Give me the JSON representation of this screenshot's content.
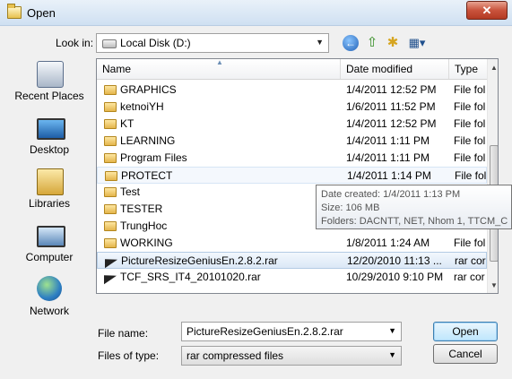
{
  "window": {
    "title": "Open",
    "close_label": "✕"
  },
  "toolbar": {
    "look_in_label": "Look in:",
    "look_in_value": "Local Disk (D:)"
  },
  "places": [
    {
      "label": "Recent Places",
      "icon": "recent-places-icon"
    },
    {
      "label": "Desktop",
      "icon": "desktop-icon"
    },
    {
      "label": "Libraries",
      "icon": "libraries-icon"
    },
    {
      "label": "Computer",
      "icon": "computer-icon"
    },
    {
      "label": "Network",
      "icon": "network-icon"
    }
  ],
  "columns": {
    "name": "Name",
    "date": "Date modified",
    "type": "Type"
  },
  "files": [
    {
      "name": "GRAPHICS",
      "date": "1/4/2011 12:52 PM",
      "type": "File fol",
      "kind": "folder"
    },
    {
      "name": "ketnoiYH",
      "date": "1/6/2011 11:52 PM",
      "type": "File fol",
      "kind": "folder"
    },
    {
      "name": "KT",
      "date": "1/4/2011 12:52 PM",
      "type": "File fol",
      "kind": "folder"
    },
    {
      "name": "LEARNING",
      "date": "1/4/2011 1:11 PM",
      "type": "File fol",
      "kind": "folder"
    },
    {
      "name": "Program Files",
      "date": "1/4/2011 1:11 PM",
      "type": "File fol",
      "kind": "folder"
    },
    {
      "name": "PROTECT",
      "date": "1/4/2011 1:14 PM",
      "type": "File fol",
      "kind": "folder"
    },
    {
      "name": "Test",
      "date": "",
      "type": "",
      "kind": "folder"
    },
    {
      "name": "TESTER",
      "date": "",
      "type": "",
      "kind": "folder"
    },
    {
      "name": "TrungHoc",
      "date": "",
      "type": "",
      "kind": "folder"
    },
    {
      "name": "WORKING",
      "date": "1/8/2011 1:24 AM",
      "type": "File fol",
      "kind": "folder"
    },
    {
      "name": "PictureResizeGeniusEn.2.8.2.rar",
      "date": "12/20/2010 11:13 ...",
      "type": "rar cor",
      "kind": "rar"
    },
    {
      "name": "TCF_SRS_IT4_20101020.rar",
      "date": "10/29/2010 9:10 PM",
      "type": "rar cor",
      "kind": "rar"
    }
  ],
  "tooltip": {
    "created": "Date created: 1/4/2011 1:13 PM",
    "size": "Size: 106 MB",
    "folders": "Folders: DACNTT, NET, Nhom 1, TTCM_C"
  },
  "bottom": {
    "file_name_label": "File name:",
    "file_name_value": "PictureResizeGeniusEn.2.8.2.rar",
    "file_type_label": "Files of type:",
    "file_type_value": "rar compressed files",
    "open_label": "Open",
    "cancel_label": "Cancel"
  }
}
